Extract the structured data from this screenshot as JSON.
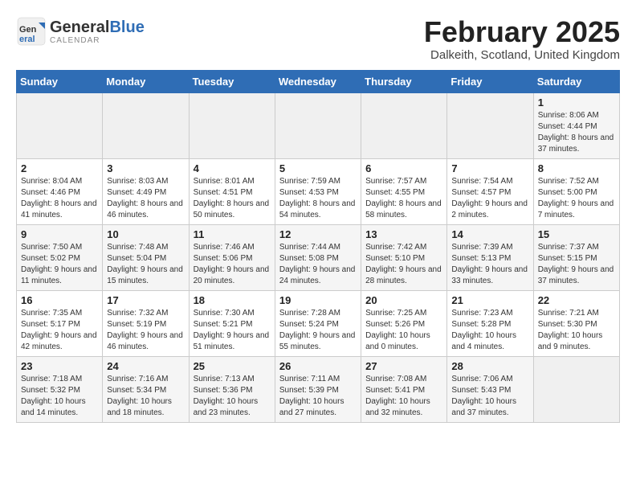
{
  "header": {
    "logo_general": "General",
    "logo_blue": "Blue",
    "month_title": "February 2025",
    "location": "Dalkeith, Scotland, United Kingdom"
  },
  "weekdays": [
    "Sunday",
    "Monday",
    "Tuesday",
    "Wednesday",
    "Thursday",
    "Friday",
    "Saturday"
  ],
  "weeks": [
    [
      {
        "day": "",
        "info": ""
      },
      {
        "day": "",
        "info": ""
      },
      {
        "day": "",
        "info": ""
      },
      {
        "day": "",
        "info": ""
      },
      {
        "day": "",
        "info": ""
      },
      {
        "day": "",
        "info": ""
      },
      {
        "day": "1",
        "info": "Sunrise: 8:06 AM\nSunset: 4:44 PM\nDaylight: 8 hours and 37 minutes."
      }
    ],
    [
      {
        "day": "2",
        "info": "Sunrise: 8:04 AM\nSunset: 4:46 PM\nDaylight: 8 hours and 41 minutes."
      },
      {
        "day": "3",
        "info": "Sunrise: 8:03 AM\nSunset: 4:49 PM\nDaylight: 8 hours and 46 minutes."
      },
      {
        "day": "4",
        "info": "Sunrise: 8:01 AM\nSunset: 4:51 PM\nDaylight: 8 hours and 50 minutes."
      },
      {
        "day": "5",
        "info": "Sunrise: 7:59 AM\nSunset: 4:53 PM\nDaylight: 8 hours and 54 minutes."
      },
      {
        "day": "6",
        "info": "Sunrise: 7:57 AM\nSunset: 4:55 PM\nDaylight: 8 hours and 58 minutes."
      },
      {
        "day": "7",
        "info": "Sunrise: 7:54 AM\nSunset: 4:57 PM\nDaylight: 9 hours and 2 minutes."
      },
      {
        "day": "8",
        "info": "Sunrise: 7:52 AM\nSunset: 5:00 PM\nDaylight: 9 hours and 7 minutes."
      }
    ],
    [
      {
        "day": "9",
        "info": "Sunrise: 7:50 AM\nSunset: 5:02 PM\nDaylight: 9 hours and 11 minutes."
      },
      {
        "day": "10",
        "info": "Sunrise: 7:48 AM\nSunset: 5:04 PM\nDaylight: 9 hours and 15 minutes."
      },
      {
        "day": "11",
        "info": "Sunrise: 7:46 AM\nSunset: 5:06 PM\nDaylight: 9 hours and 20 minutes."
      },
      {
        "day": "12",
        "info": "Sunrise: 7:44 AM\nSunset: 5:08 PM\nDaylight: 9 hours and 24 minutes."
      },
      {
        "day": "13",
        "info": "Sunrise: 7:42 AM\nSunset: 5:10 PM\nDaylight: 9 hours and 28 minutes."
      },
      {
        "day": "14",
        "info": "Sunrise: 7:39 AM\nSunset: 5:13 PM\nDaylight: 9 hours and 33 minutes."
      },
      {
        "day": "15",
        "info": "Sunrise: 7:37 AM\nSunset: 5:15 PM\nDaylight: 9 hours and 37 minutes."
      }
    ],
    [
      {
        "day": "16",
        "info": "Sunrise: 7:35 AM\nSunset: 5:17 PM\nDaylight: 9 hours and 42 minutes."
      },
      {
        "day": "17",
        "info": "Sunrise: 7:32 AM\nSunset: 5:19 PM\nDaylight: 9 hours and 46 minutes."
      },
      {
        "day": "18",
        "info": "Sunrise: 7:30 AM\nSunset: 5:21 PM\nDaylight: 9 hours and 51 minutes."
      },
      {
        "day": "19",
        "info": "Sunrise: 7:28 AM\nSunset: 5:24 PM\nDaylight: 9 hours and 55 minutes."
      },
      {
        "day": "20",
        "info": "Sunrise: 7:25 AM\nSunset: 5:26 PM\nDaylight: 10 hours and 0 minutes."
      },
      {
        "day": "21",
        "info": "Sunrise: 7:23 AM\nSunset: 5:28 PM\nDaylight: 10 hours and 4 minutes."
      },
      {
        "day": "22",
        "info": "Sunrise: 7:21 AM\nSunset: 5:30 PM\nDaylight: 10 hours and 9 minutes."
      }
    ],
    [
      {
        "day": "23",
        "info": "Sunrise: 7:18 AM\nSunset: 5:32 PM\nDaylight: 10 hours and 14 minutes."
      },
      {
        "day": "24",
        "info": "Sunrise: 7:16 AM\nSunset: 5:34 PM\nDaylight: 10 hours and 18 minutes."
      },
      {
        "day": "25",
        "info": "Sunrise: 7:13 AM\nSunset: 5:36 PM\nDaylight: 10 hours and 23 minutes."
      },
      {
        "day": "26",
        "info": "Sunrise: 7:11 AM\nSunset: 5:39 PM\nDaylight: 10 hours and 27 minutes."
      },
      {
        "day": "27",
        "info": "Sunrise: 7:08 AM\nSunset: 5:41 PM\nDaylight: 10 hours and 32 minutes."
      },
      {
        "day": "28",
        "info": "Sunrise: 7:06 AM\nSunset: 5:43 PM\nDaylight: 10 hours and 37 minutes."
      },
      {
        "day": "",
        "info": ""
      }
    ]
  ]
}
